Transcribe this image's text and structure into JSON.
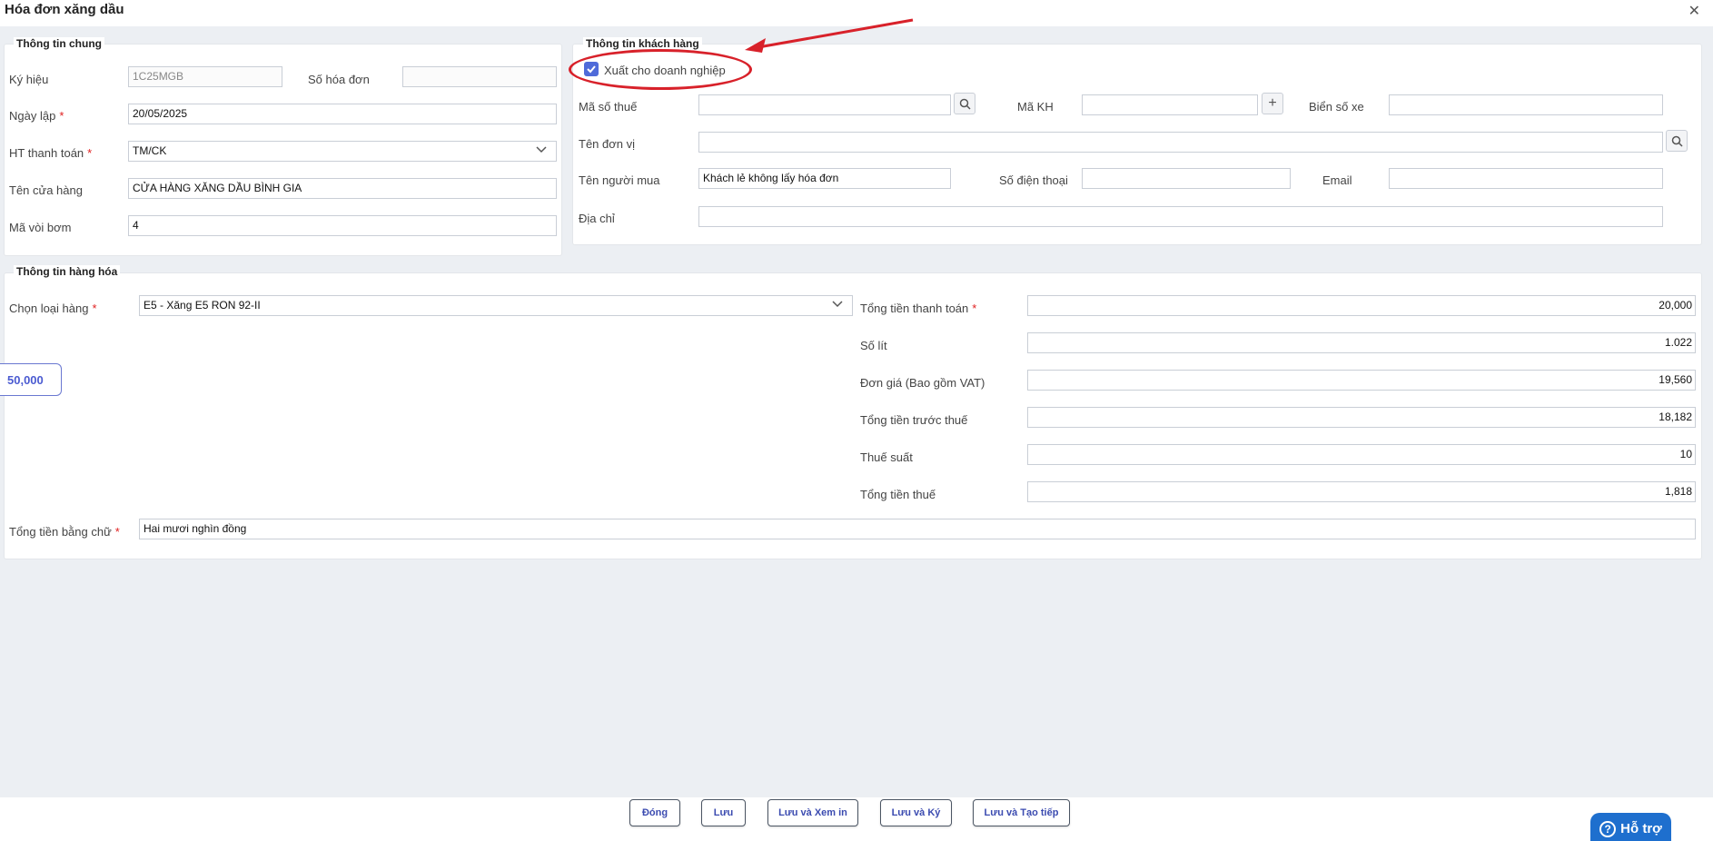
{
  "window": {
    "title": "Hóa đơn xăng dầu"
  },
  "general": {
    "legend": "Thông tin chung",
    "ky_hieu_label": "Ký hiệu",
    "ky_hieu_value": "1C25MGB",
    "so_hoa_don_label": "Số hóa đơn",
    "so_hoa_don_value": "",
    "ngay_lap_label": "Ngày lập",
    "ngay_lap_value": "20/05/2025",
    "ht_thanh_toan_label": "HT thanh toán",
    "ht_thanh_toan_value": "TM/CK",
    "ten_cua_hang_label": "Tên cửa hàng",
    "ten_cua_hang_value": "CỬA HÀNG XĂNG DẦU BÌNH GIA",
    "ma_voi_bom_label": "Mã vòi bơm",
    "ma_voi_bom_value": "4",
    "required_mark": "*"
  },
  "customer": {
    "legend": "Thông tin khách hàng",
    "xuat_doanh_nghiep_label": "Xuất cho doanh nghiệp",
    "xuat_doanh_nghiep_checked": true,
    "ma_so_thue_label": "Mã số thuế",
    "ma_so_thue_value": "",
    "ma_kh_label": "Mã KH",
    "ma_kh_value": "",
    "bien_so_xe_label": "Biển số xe",
    "bien_so_xe_value": "",
    "ten_don_vi_label": "Tên đơn vị",
    "ten_don_vi_value": "",
    "ten_nguoi_mua_label": "Tên người mua",
    "ten_nguoi_mua_value": "Khách lẻ không lấy hóa đơn",
    "so_dien_thoai_label": "Số điện thoại",
    "so_dien_thoai_value": "",
    "email_label": "Email",
    "email_value": "",
    "dia_chi_label": "Địa chỉ",
    "dia_chi_value": ""
  },
  "goods": {
    "legend": "Thông tin hàng hóa",
    "chon_loai_hang_label": "Chọn loại hàng",
    "chon_loai_hang_value": "E5 - Xăng E5 RON 92-II",
    "quick_amount": "50,000",
    "tong_tien_thanh_toan_label": "Tổng tiền thanh toán",
    "tong_tien_thanh_toan_value": "20,000",
    "so_lit_label": "Số lít",
    "so_lit_value": "1.022",
    "don_gia_label": "Đơn giá (Bao gồm VAT)",
    "don_gia_value": "19,560",
    "tong_tien_truoc_thue_label": "Tổng tiền trước thuế",
    "tong_tien_truoc_thue_value": "18,182",
    "thue_suat_label": "Thuế suất",
    "thue_suat_value": "10",
    "tong_tien_thue_label": "Tổng tiền thuế",
    "tong_tien_thue_value": "1,818",
    "tong_tien_bang_chu_label": "Tổng tiền bằng chữ",
    "tong_tien_bang_chu_value": "Hai mươi nghìn đồng"
  },
  "footer": {
    "dong": "Đóng",
    "luu": "Lưu",
    "luu_xem_in": "Lưu và Xem in",
    "luu_ky": "Lưu và Ký",
    "luu_tao_tiep": "Lưu và Tạo tiếp",
    "help": "Hỗ trợ"
  },
  "colors": {
    "accent": "#4f6bd9",
    "annotation_red": "#d8212a",
    "help_blue": "#1e6fce"
  }
}
